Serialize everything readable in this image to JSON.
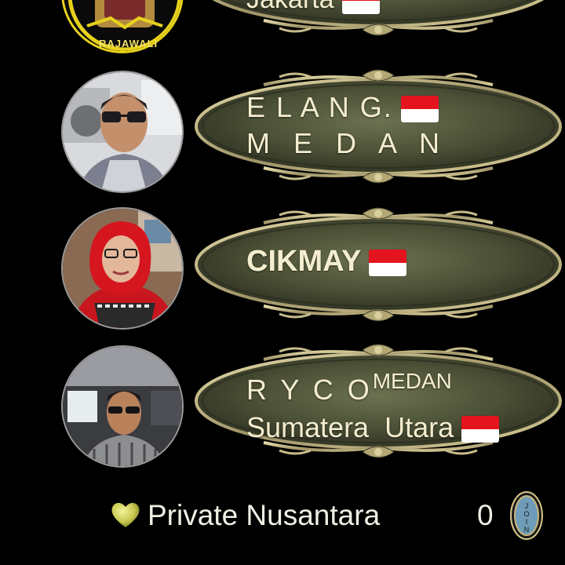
{
  "members": [
    {
      "line1": "Jakarta",
      "line2": "",
      "avatar_icon": "rajawali-emblem-avatar",
      "avatar_caption": "RAJAWALI",
      "flag": "indonesia-flag-icon"
    },
    {
      "line1": "E L A N G.",
      "line2": "M E D A N",
      "avatar_icon": "man-sunglasses-avatar",
      "flag": "indonesia-flag-icon"
    },
    {
      "line1": "CIKMAY",
      "line2": "",
      "avatar_icon": "woman-red-hijab-avatar",
      "flag": "indonesia-flag-icon"
    },
    {
      "line1_main": "R  Y  C  O",
      "line1_sup": "MEDAN",
      "line2": "Sumatera  Utara",
      "avatar_icon": "man-in-car-avatar",
      "flag": "indonesia-flag-icon"
    }
  ],
  "footer": {
    "heart_icon": "green-heart-icon",
    "title": "Private Nusantara",
    "count": "0",
    "badge_icon": "community-badge-icon",
    "badge_letters": "JOIN"
  },
  "colors": {
    "background": "#000000",
    "plaque_fill": "#4c5137",
    "plaque_border": "#b8ad7c",
    "text": "#f4edcf",
    "flag_red": "#e4141e",
    "flag_white": "#ffffff",
    "heart": "#c8c850"
  }
}
